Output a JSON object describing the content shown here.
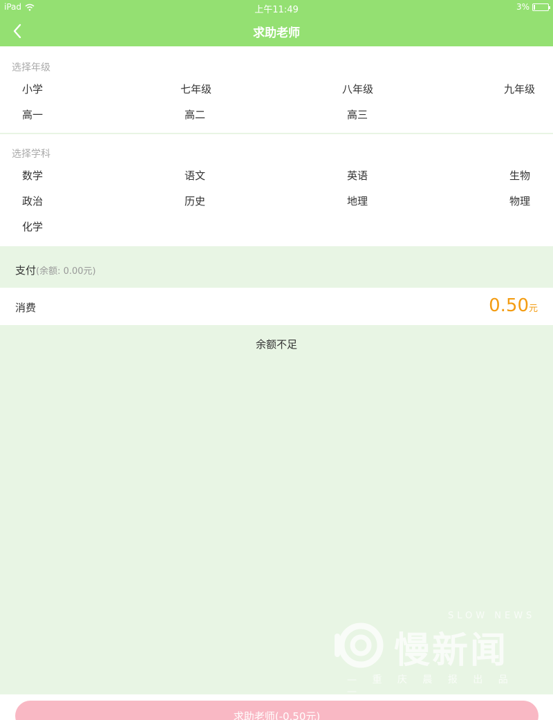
{
  "status_bar": {
    "device": "iPad",
    "time": "上午11:49",
    "battery": "3%"
  },
  "nav": {
    "title": "求助老师",
    "back_icon": "chevron-left-icon"
  },
  "grade_section": {
    "label": "选择年级",
    "options": [
      "小学",
      "七年级",
      "八年级",
      "九年级",
      "高一",
      "高二",
      "高三"
    ]
  },
  "subject_section": {
    "label": "选择学科",
    "options": [
      "数学",
      "语文",
      "英语",
      "生物",
      "政治",
      "历史",
      "地理",
      "物理",
      "化学"
    ]
  },
  "payment": {
    "title": "支付",
    "balance": "(余额: 0.00元)",
    "spend_label": "消费",
    "amount": "0.50",
    "unit": "元",
    "notice": "余额不足"
  },
  "watermark": {
    "en": "SLOW NEWS",
    "cn": "慢新闻",
    "sub": "— 重 庆 晨 报 出 品 —"
  },
  "action": {
    "label": "求助老师(-0.50元)"
  },
  "colors": {
    "nav": "#94e072",
    "accent_amount": "#f39c12",
    "button": "#f9b8c4",
    "background": "#e8f5e4"
  }
}
